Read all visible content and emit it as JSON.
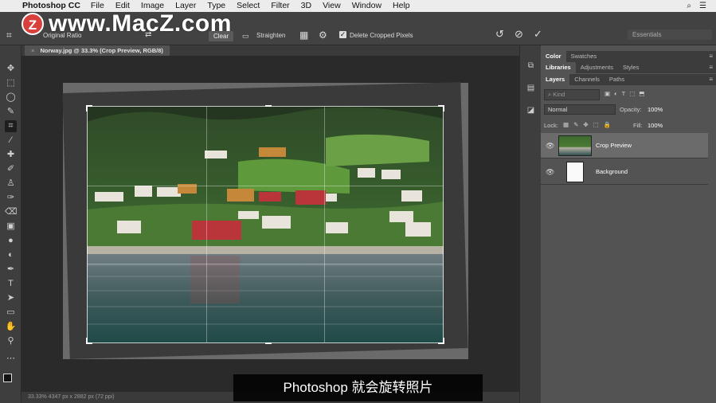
{
  "menubar": {
    "app_name": "Photoshop CC",
    "items": [
      "File",
      "Edit",
      "Image",
      "Layer",
      "Type",
      "Select",
      "Filter",
      "3D",
      "View",
      "Window",
      "Help"
    ]
  },
  "watermark": {
    "logo": "Z",
    "text": "www.MacZ.com"
  },
  "options": {
    "ratio": "Original Ratio",
    "clear_label": "Clear",
    "straighten_label": "Straighten",
    "delete_pixels_label": "Delete Cropped Pixels",
    "delete_pixels_checked": true,
    "workspace": "Essentials"
  },
  "document": {
    "tab_title": "Norway.jpg @ 33.3% (Crop Preview, RGB/8)",
    "status": "33.33%     4347 px x 2882 px (72 ppi)"
  },
  "panels": {
    "top_tabs": [
      "Color",
      "Swatches"
    ],
    "mid_tabs": [
      "Libraries",
      "Adjustments",
      "Styles"
    ],
    "layer_tabs": [
      "Layers",
      "Channels",
      "Paths"
    ],
    "kind_placeholder": "Kind",
    "blend_mode": "Normal",
    "opacity_label": "Opacity:",
    "opacity_value": "100%",
    "lock_label": "Lock:",
    "fill_label": "Fill:",
    "fill_value": "100%",
    "layers": [
      {
        "name": "Crop Preview",
        "selected": true
      },
      {
        "name": "Background",
        "selected": false
      }
    ]
  },
  "subtitle": "Photoshop 就会旋转照片",
  "colors": {
    "accent": "#d8403c",
    "panel_bg": "#535353",
    "canvas_bg": "#2a2a2a"
  }
}
